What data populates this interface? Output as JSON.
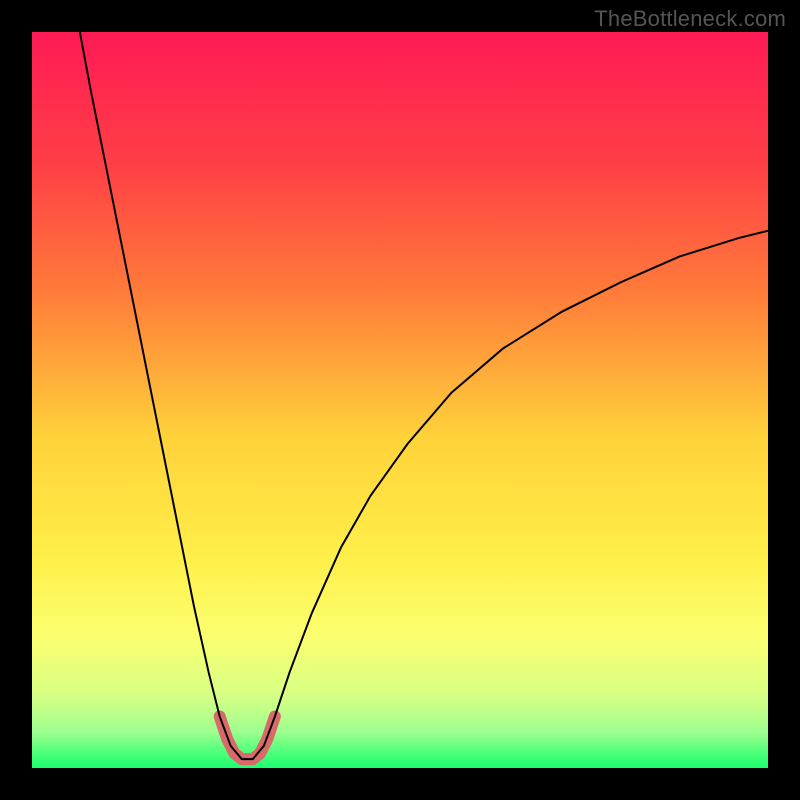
{
  "watermark": "TheBottleneck.com",
  "chart_data": {
    "type": "line",
    "title": "",
    "xlabel": "",
    "ylabel": "",
    "xlim": [
      0,
      100
    ],
    "ylim": [
      0,
      100
    ],
    "gradient_stops": [
      {
        "offset": 0,
        "color": "#ff1a55"
      },
      {
        "offset": 18,
        "color": "#ff3f46"
      },
      {
        "offset": 35,
        "color": "#ff7a3a"
      },
      {
        "offset": 55,
        "color": "#ffd23a"
      },
      {
        "offset": 72,
        "color": "#fff04a"
      },
      {
        "offset": 82,
        "color": "#fbff6f"
      },
      {
        "offset": 90,
        "color": "#d8ff85"
      },
      {
        "offset": 95,
        "color": "#9fff8f"
      },
      {
        "offset": 98,
        "color": "#4bff7a"
      },
      {
        "offset": 100,
        "color": "#1aff70"
      }
    ],
    "series": [
      {
        "name": "bottleneck-curve",
        "color": "#000000",
        "width": 2,
        "points": [
          {
            "x": 6.5,
            "y": 100
          },
          {
            "x": 8,
            "y": 92
          },
          {
            "x": 10,
            "y": 82
          },
          {
            "x": 12,
            "y": 72
          },
          {
            "x": 14,
            "y": 62
          },
          {
            "x": 16,
            "y": 52
          },
          {
            "x": 18,
            "y": 42
          },
          {
            "x": 20,
            "y": 32
          },
          {
            "x": 22,
            "y": 22
          },
          {
            "x": 24,
            "y": 13
          },
          {
            "x": 25.5,
            "y": 7
          },
          {
            "x": 27,
            "y": 3
          },
          {
            "x": 28.5,
            "y": 1.2
          },
          {
            "x": 30,
            "y": 1.2
          },
          {
            "x": 31.5,
            "y": 3
          },
          {
            "x": 33,
            "y": 7
          },
          {
            "x": 35,
            "y": 13
          },
          {
            "x": 38,
            "y": 21
          },
          {
            "x": 42,
            "y": 30
          },
          {
            "x": 46,
            "y": 37
          },
          {
            "x": 51,
            "y": 44
          },
          {
            "x": 57,
            "y": 51
          },
          {
            "x": 64,
            "y": 57
          },
          {
            "x": 72,
            "y": 62
          },
          {
            "x": 80,
            "y": 66
          },
          {
            "x": 88,
            "y": 69.5
          },
          {
            "x": 96,
            "y": 72
          },
          {
            "x": 100,
            "y": 73
          }
        ]
      },
      {
        "name": "highlight-valley",
        "color": "#d86a6a",
        "width": 12,
        "linecap": "round",
        "points": [
          {
            "x": 25.5,
            "y": 7
          },
          {
            "x": 26.5,
            "y": 4
          },
          {
            "x": 27.5,
            "y": 2
          },
          {
            "x": 28.5,
            "y": 1.2
          },
          {
            "x": 30,
            "y": 1.2
          },
          {
            "x": 31,
            "y": 2
          },
          {
            "x": 32,
            "y": 4
          },
          {
            "x": 33,
            "y": 7
          }
        ]
      }
    ]
  }
}
